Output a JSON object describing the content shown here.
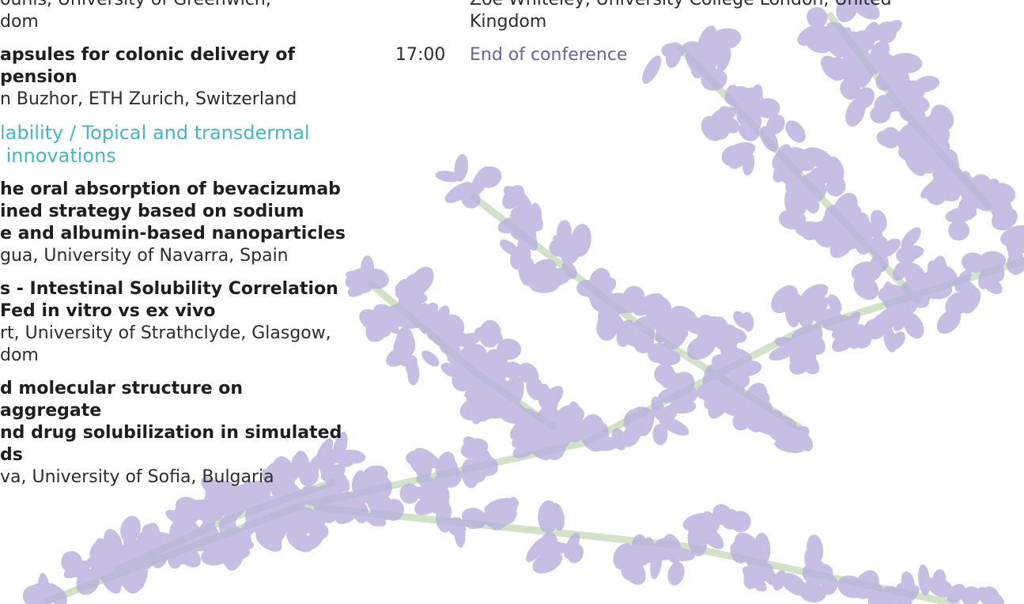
{
  "left": {
    "b1_line1": "ounis, University of Greenwich,",
    "b1_line2": "dom",
    "b2_title1": "apsules for colonic delivery of",
    "b2_title2": "pension",
    "b2_author": "n Buzhor, ETH Zurich, Switzerland",
    "session1": "lability / Topical and transdermal",
    "session2": " innovations",
    "b3_title1": "he oral absorption of bevacizumab",
    "b3_title2": "ined strategy based on sodium",
    "b3_title3": "e and albumin-based nanoparticles",
    "b3_author": "gua, University of Navarra, Spain",
    "b4_title1": "s - Intestinal Solubility Correlation",
    "b4_title2": "Fed in vitro vs ex vivo",
    "b4_author1": "rt, University of Strathclyde, Glasgow,",
    "b4_author2": "dom",
    "b5_title1": "d molecular structure on aggregate",
    "b5_title2": "nd drug solubilization in simulated",
    "b5_title3": "ds",
    "b5_author": "va, University of Sofia, Bulgaria"
  },
  "right": {
    "author_line1": "Zoë Whiteley, University College London, United",
    "author_line2": "Kingdom",
    "time": "17:00",
    "end_text": "End of conference"
  },
  "colors": {
    "session_heading": "#43b8c2",
    "end_text": "#6d5fa0",
    "flower": "#b8b0dd",
    "stem": "#d2e2c6"
  }
}
